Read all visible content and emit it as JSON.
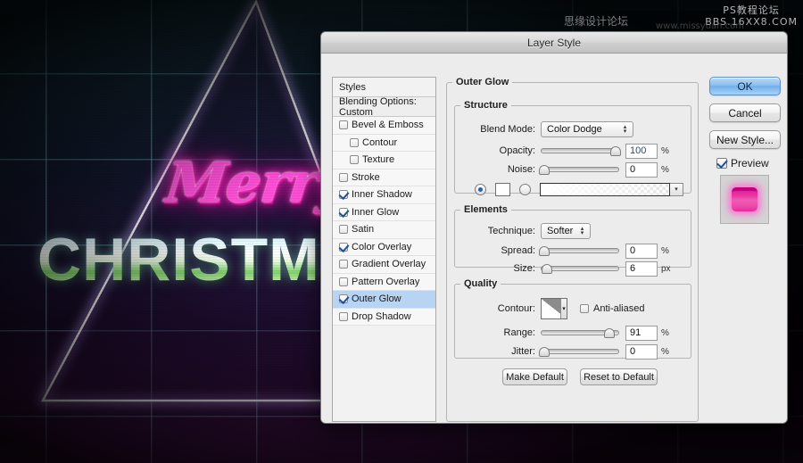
{
  "artwork": {
    "merry_text": "Merry",
    "christmas_text": "CHRISTM"
  },
  "watermark": {
    "line1": "PS教程论坛",
    "line2": "BBS.16XX8.COM",
    "left_text": "思缘设计论坛",
    "faint_url": "www.missyuan.com"
  },
  "dialog": {
    "title": "Layer Style",
    "styles": {
      "header": "Styles",
      "blending_options": "Blending Options: Custom",
      "items": [
        {
          "label": "Bevel & Emboss",
          "checked": false,
          "indent": false,
          "selected": false
        },
        {
          "label": "Contour",
          "checked": false,
          "indent": true,
          "selected": false
        },
        {
          "label": "Texture",
          "checked": false,
          "indent": true,
          "selected": false
        },
        {
          "label": "Stroke",
          "checked": false,
          "indent": false,
          "selected": false
        },
        {
          "label": "Inner Shadow",
          "checked": true,
          "indent": false,
          "selected": false
        },
        {
          "label": "Inner Glow",
          "checked": true,
          "indent": false,
          "selected": false
        },
        {
          "label": "Satin",
          "checked": false,
          "indent": false,
          "selected": false
        },
        {
          "label": "Color Overlay",
          "checked": true,
          "indent": false,
          "selected": false
        },
        {
          "label": "Gradient Overlay",
          "checked": false,
          "indent": false,
          "selected": false
        },
        {
          "label": "Pattern Overlay",
          "checked": false,
          "indent": false,
          "selected": false
        },
        {
          "label": "Outer Glow",
          "checked": true,
          "indent": false,
          "selected": true
        },
        {
          "label": "Drop Shadow",
          "checked": false,
          "indent": false,
          "selected": false
        }
      ]
    },
    "panel": {
      "group_title": "Outer Glow",
      "structure": {
        "title": "Structure",
        "blend_mode_label": "Blend Mode:",
        "blend_mode_value": "Color Dodge",
        "opacity_label": "Opacity:",
        "opacity_value": "100",
        "opacity_unit": "%",
        "opacity_pct": 100,
        "noise_label": "Noise:",
        "noise_value": "0",
        "noise_unit": "%",
        "noise_pct": 0,
        "fill_type": "gradient",
        "color_swatch_hex": "#ffffff"
      },
      "elements": {
        "title": "Elements",
        "technique_label": "Technique:",
        "technique_value": "Softer",
        "spread_label": "Spread:",
        "spread_value": "0",
        "spread_unit": "%",
        "spread_pct": 0,
        "size_label": "Size:",
        "size_value": "6",
        "size_unit": "px",
        "size_pct": 4
      },
      "quality": {
        "title": "Quality",
        "contour_label": "Contour:",
        "antialiased_label": "Anti-aliased",
        "antialiased_checked": false,
        "range_label": "Range:",
        "range_value": "91",
        "range_unit": "%",
        "range_pct": 91,
        "jitter_label": "Jitter:",
        "jitter_value": "0",
        "jitter_unit": "%",
        "jitter_pct": 0
      },
      "make_default": "Make Default",
      "reset_to_default": "Reset to Default"
    },
    "buttons": {
      "ok": "OK",
      "cancel": "Cancel",
      "new_style": "New Style...",
      "preview_label": "Preview",
      "preview_checked": true
    }
  },
  "colors": {
    "accent_blue": "#6fb0ea",
    "selection_blue": "#b7d4f2",
    "dialog_bg": "#ececec",
    "neon_pink": "#ff4fd8",
    "neon_cyan": "#78dce6"
  }
}
